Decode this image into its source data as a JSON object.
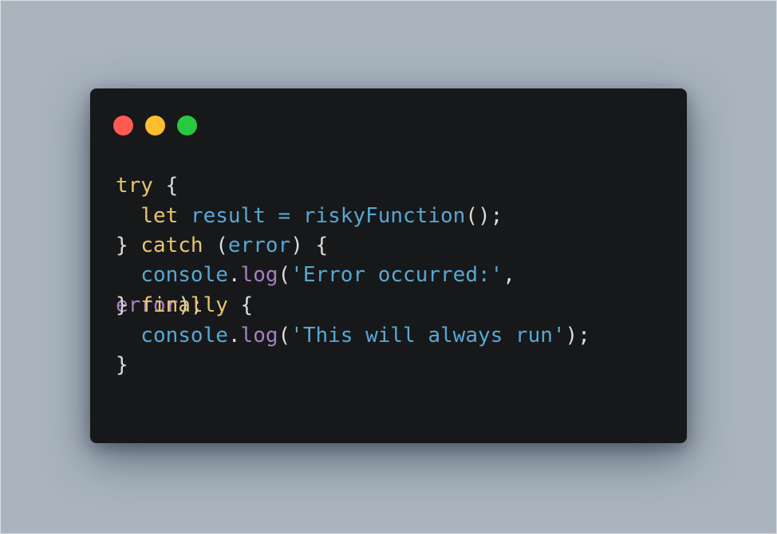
{
  "colors": {
    "background": "#a9b4bf",
    "window": "#17181a",
    "traffic_red": "#ff5a52",
    "traffic_yellow": "#ffbe2e",
    "traffic_green": "#28c93f",
    "keyword": "#e7c56b",
    "identifier": "#56a8d3",
    "method": "#a77fc1",
    "string": "#56a8d3",
    "punctuation": "#dcdcdc"
  },
  "code": {
    "lines": [
      [
        {
          "t": "try",
          "c": "keyword"
        },
        {
          "t": " {",
          "c": "punctuation"
        }
      ],
      [
        {
          "t": "  ",
          "c": "punctuation"
        },
        {
          "t": "let",
          "c": "keyword"
        },
        {
          "t": " result = riskyFunction",
          "c": "identifier"
        },
        {
          "t": "();",
          "c": "punctuation"
        }
      ],
      [
        {
          "t": "} ",
          "c": "punctuation"
        },
        {
          "t": "catch",
          "c": "keyword"
        },
        {
          "t": " (",
          "c": "punctuation"
        },
        {
          "t": "error",
          "c": "identifier"
        },
        {
          "t": ") {",
          "c": "punctuation"
        }
      ],
      [
        {
          "t": "  console",
          "c": "identifier"
        },
        {
          "t": ".",
          "c": "punctuation"
        },
        {
          "t": "log",
          "c": "method"
        },
        {
          "t": "(",
          "c": "punctuation"
        },
        {
          "t": "'Error occurred:'",
          "c": "string"
        },
        {
          "t": ",",
          "c": "punctuation"
        }
      ],
      [
        {
          "t": "error",
          "c": "method"
        },
        {
          "t": ");",
          "c": "punctuation"
        }
      ],
      [
        {
          "t": "} ",
          "c": "punctuation"
        },
        {
          "t": "finally",
          "c": "keyword"
        },
        {
          "t": " {",
          "c": "punctuation"
        }
      ],
      [
        {
          "t": "  console",
          "c": "identifier"
        },
        {
          "t": ".",
          "c": "punctuation"
        },
        {
          "t": "log",
          "c": "method"
        },
        {
          "t": "(",
          "c": "punctuation"
        },
        {
          "t": "'This will always run'",
          "c": "string"
        },
        {
          "t": ");",
          "c": "punctuation"
        }
      ],
      [
        {
          "t": "}",
          "c": "punctuation"
        }
      ]
    ]
  }
}
